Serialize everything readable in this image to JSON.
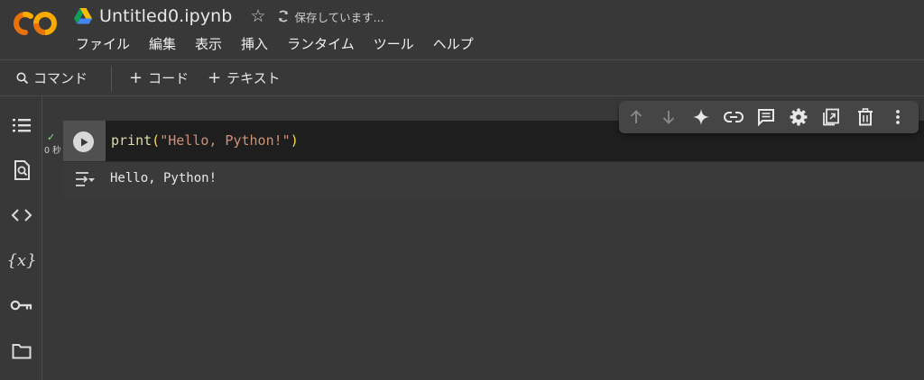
{
  "header": {
    "logo_text": "CO",
    "title": "Untitled0.ipynb",
    "star_glyph": "☆",
    "saving_status": "保存しています..."
  },
  "menu": {
    "items": [
      "ファイル",
      "編集",
      "表示",
      "挿入",
      "ランタイム",
      "ツール",
      "ヘルプ"
    ]
  },
  "toolbar": {
    "command_label": "コマンド",
    "add_code_label": "コード",
    "add_text_label": "テキスト",
    "plus_glyph": "+"
  },
  "sidebar": {
    "icons": [
      "table-of-contents-icon",
      "find-icon",
      "code-snippets-icon",
      "variables-icon",
      "secrets-key-icon",
      "files-folder-icon"
    ]
  },
  "cell": {
    "exec_check": "✓",
    "exec_time": "0 秒",
    "code": {
      "fn": "print",
      "open_paren": "(",
      "string": "\"Hello, Python!\"",
      "close_paren": ")"
    },
    "output": "Hello, Python!"
  },
  "cell_toolbar": {
    "icons": [
      "move-up-icon",
      "move-down-icon",
      "gemini-sparkle-icon",
      "link-icon",
      "comment-icon",
      "settings-gear-icon",
      "open-in-tab-icon",
      "delete-icon",
      "more-vert-icon"
    ]
  },
  "colors": {
    "background": "#383838",
    "code_background": "#1e1e1e",
    "logo_orange": "#f9ab00",
    "logo_dark_orange": "#e8710a",
    "string_color": "#ce9178",
    "function_color": "#dcdcaa"
  }
}
